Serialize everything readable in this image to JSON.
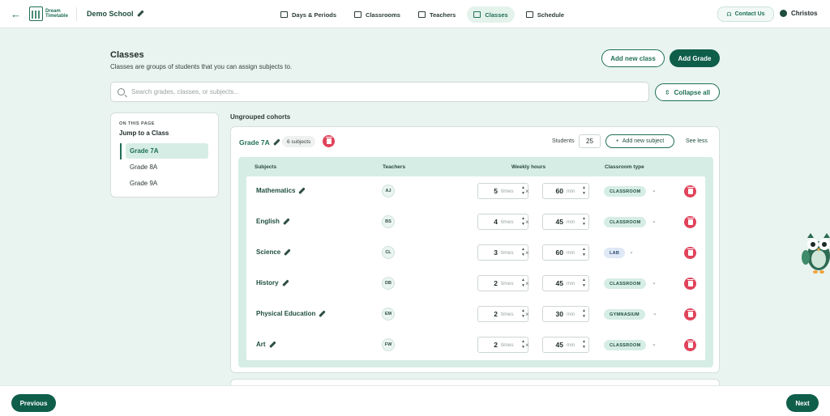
{
  "app": {
    "logo_line1": "Dream",
    "logo_line2": "Timetable",
    "school": "Demo School"
  },
  "nav": [
    {
      "label": "Days & Periods"
    },
    {
      "label": "Classrooms"
    },
    {
      "label": "Teachers"
    },
    {
      "label": "Classes"
    },
    {
      "label": "Schedule"
    }
  ],
  "contact": "Contact Us",
  "user": "Christos",
  "header": {
    "title": "Classes",
    "subtitle": "Classes are groups of students that you can assign subjects to.",
    "add_class": "Add new class",
    "add_grade": "Add Grade",
    "collapse": "Collapse all"
  },
  "search": {
    "placeholder": "Search grades, classes, or subjects..."
  },
  "toc": {
    "kicker": "ON THIS PAGE",
    "title": "Jump to a Class",
    "items": [
      "Grade 7A",
      "Grade 8A",
      "Grade 9A"
    ]
  },
  "group_title": "Ungrouped cohorts",
  "grade": {
    "name": "Grade 7A",
    "badge": "6 subjects",
    "students_label": "Students",
    "students": "25",
    "add_subject": "Add new subject",
    "see_less": "See less",
    "headers": {
      "subjects": "Subjects",
      "teachers": "Teachers",
      "weekly_hours": "Weekly hours",
      "classroom_type": "Classroom type"
    },
    "times_unit": "times",
    "min_unit": "min",
    "multiply": "×",
    "rows": [
      {
        "subject": "Mathematics",
        "teacher": "AJ",
        "times": "5",
        "min": "60",
        "room": "CLASSROOM"
      },
      {
        "subject": "English",
        "teacher": "BS",
        "times": "4",
        "min": "45",
        "room": "CLASSROOM"
      },
      {
        "subject": "Science",
        "teacher": "CL",
        "times": "3",
        "min": "60",
        "room": "LAB"
      },
      {
        "subject": "History",
        "teacher": "DB",
        "times": "2",
        "min": "45",
        "room": "CLASSROOM"
      },
      {
        "subject": "Physical Education",
        "teacher": "EM",
        "times": "2",
        "min": "30",
        "room": "GYMNASIUM"
      },
      {
        "subject": "Art",
        "teacher": "FW",
        "times": "2",
        "min": "45",
        "room": "CLASSROOM"
      }
    ]
  },
  "footer": {
    "previous": "Previous",
    "next": "Next"
  },
  "colors": {
    "accent": "#0f5e4a",
    "danger": "#e0435b",
    "bg": "#e9f4f0"
  }
}
